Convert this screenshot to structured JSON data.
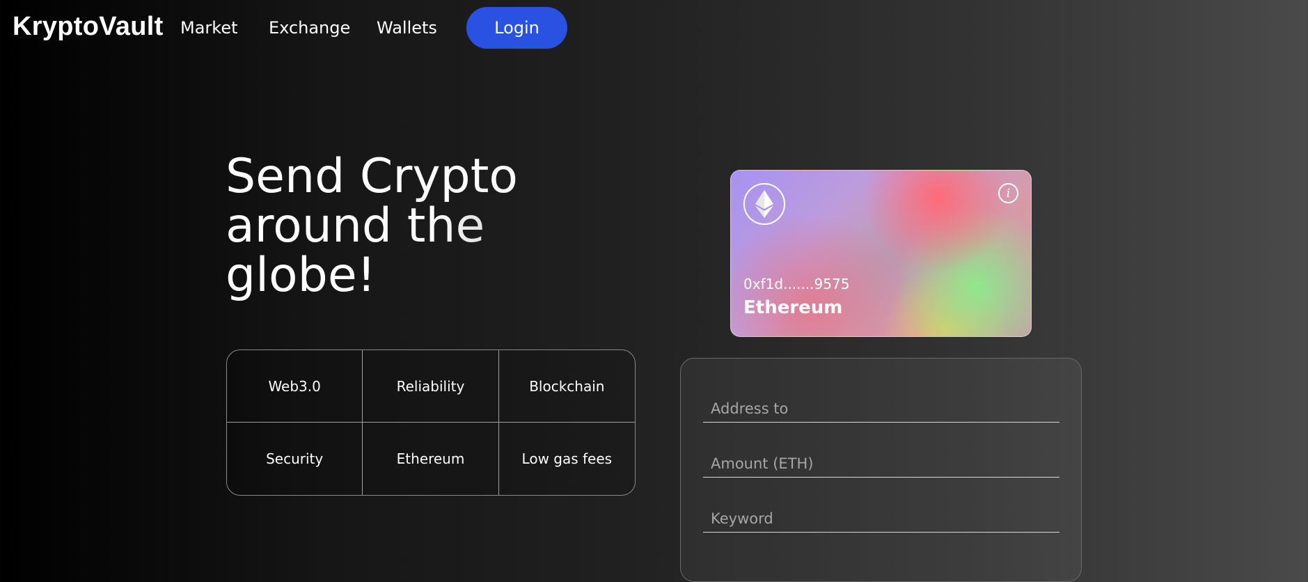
{
  "header": {
    "brand": "KryptoVault",
    "nav": [
      {
        "label": "Market"
      },
      {
        "label": "Exchange"
      },
      {
        "label": "Wallets"
      }
    ],
    "login_label": "Login",
    "accent_color": "#2952e3"
  },
  "hero": {
    "line1": "Send Crypto",
    "line2": "around the",
    "line3": "globe!"
  },
  "features": [
    "Web3.0",
    "Reliability",
    "Blockchain",
    "Security",
    "Ethereum",
    "Low gas fees"
  ],
  "card": {
    "icon": "ethereum-icon",
    "info_icon": "info-icon",
    "address": "0xf1d.......9575",
    "network": "Ethereum"
  },
  "form": {
    "address_placeholder": "Address to",
    "amount_placeholder": "Amount (ETH)",
    "keyword_placeholder": "Keyword"
  }
}
